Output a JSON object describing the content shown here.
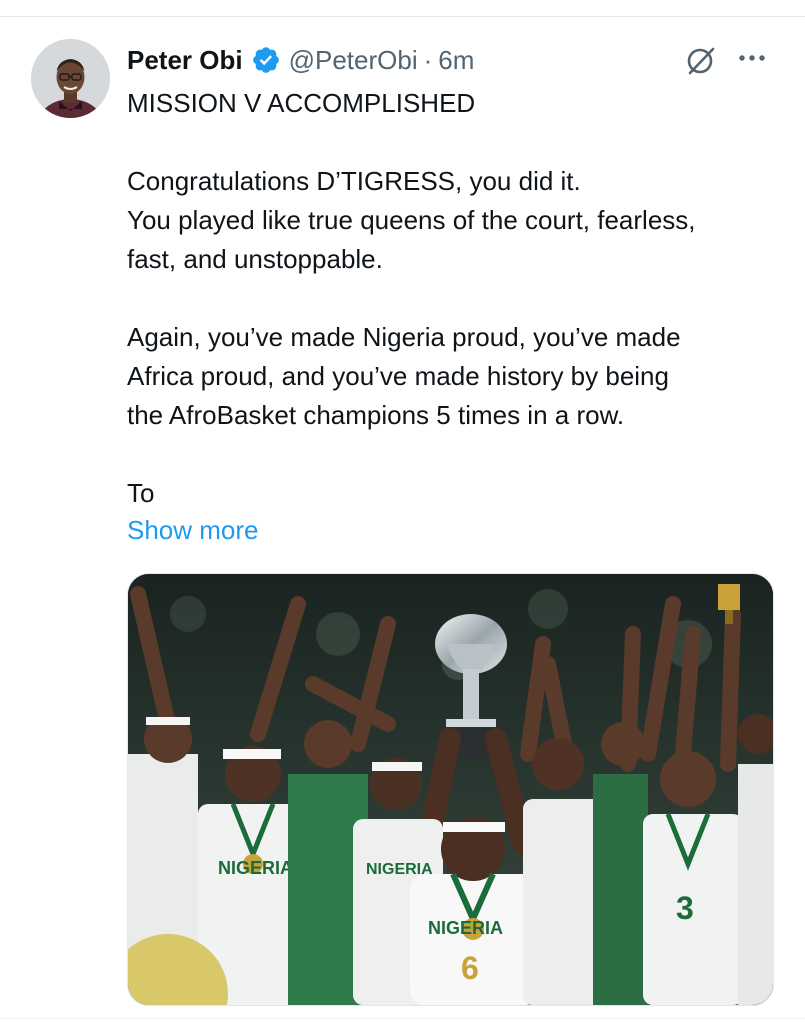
{
  "tweet": {
    "author": {
      "display_name": "Peter Obi",
      "handle": "@PeterObi",
      "verified": true,
      "avatar_icon": "profile-photo"
    },
    "separator": "·",
    "timestamp": "6m",
    "lines": [
      "MISSION V ACCOMPLISHED",
      "",
      "Congratulations D’TIGRESS, you did it.",
      "You played like true queens of the court, fearless,",
      "fast, and unstoppable.",
      "",
      "Again, you’ve made Nigeria proud, you’ve made",
      "Africa proud, and you’ve made history by being",
      "the AfroBasket champions 5 times in a row.",
      "",
      "To"
    ],
    "show_more": "Show more",
    "media": {
      "type": "photo",
      "jersey_texts": [
        "NIGERIA",
        "NIGERIA",
        "NIGERIA",
        "3",
        "6"
      ]
    },
    "icons": {
      "verified": "verified-badge-icon",
      "grok": "grok-icon",
      "more": "more-options-icon"
    },
    "colors": {
      "link": "#1d9bf0",
      "secondary_text": "#536471",
      "verified_badge": "#1d9bf0"
    }
  }
}
